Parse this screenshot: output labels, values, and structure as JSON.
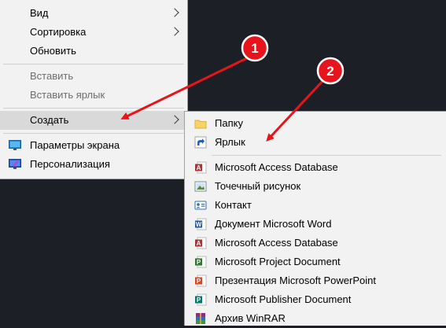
{
  "context_menu": {
    "view": "Вид",
    "sort": "Сортировка",
    "refresh": "Обновить",
    "paste": "Вставить",
    "paste_shortcut": "Вставить ярлык",
    "create": "Создать",
    "display_settings": "Параметры экрана",
    "personalization": "Персонализация"
  },
  "submenu": {
    "folder": "Папку",
    "shortcut": "Ярлык",
    "items": [
      {
        "label": "Microsoft Access Database",
        "icon": "access-icon"
      },
      {
        "label": "Точечный рисунок",
        "icon": "bitmap-icon"
      },
      {
        "label": "Контакт",
        "icon": "contact-icon"
      },
      {
        "label": "Документ Microsoft Word",
        "icon": "word-icon"
      },
      {
        "label": "Microsoft Access Database",
        "icon": "access-icon"
      },
      {
        "label": "Microsoft Project Document",
        "icon": "project-icon"
      },
      {
        "label": "Презентация Microsoft PowerPoint",
        "icon": "powerpoint-icon"
      },
      {
        "label": "Microsoft Publisher Document",
        "icon": "publisher-icon"
      },
      {
        "label": "Архив WinRAR",
        "icon": "winrar-icon"
      }
    ]
  },
  "annotations": [
    {
      "number": "1",
      "color": "#e8141b"
    },
    {
      "number": "2",
      "color": "#e8141b"
    }
  ]
}
